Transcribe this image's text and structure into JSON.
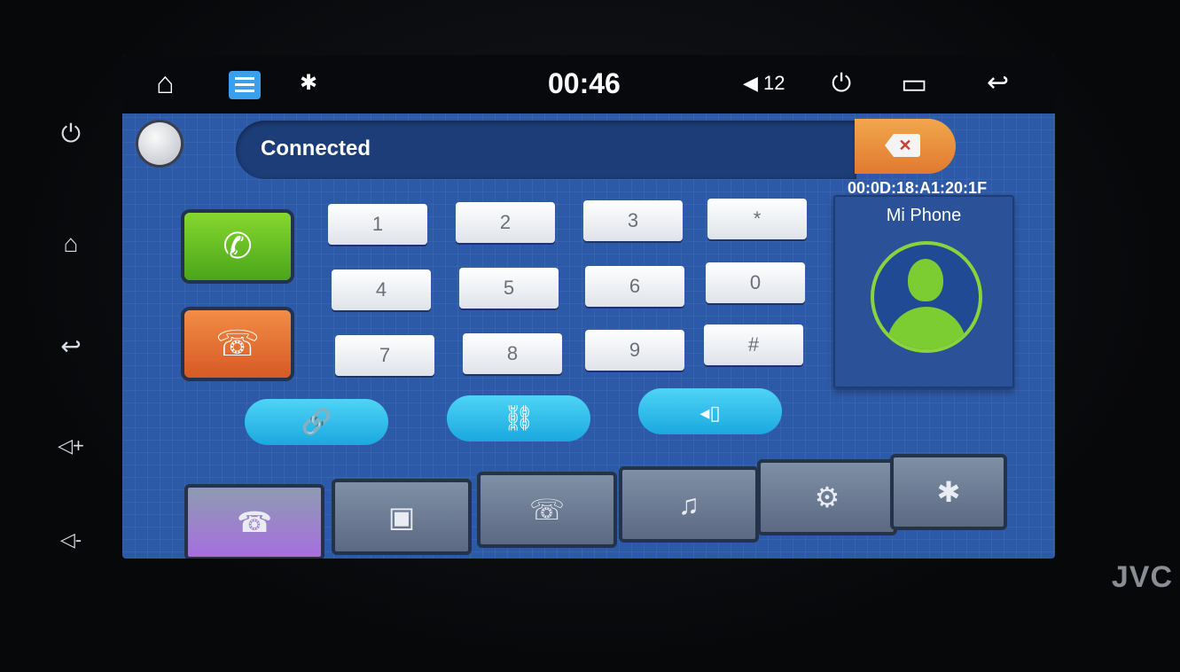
{
  "status_bar": {
    "clock": "00:46",
    "volume": "12",
    "home_icon": "⌂",
    "bluetooth_icon": "✱",
    "power_icon": "⏻",
    "recent_icon": "▭",
    "back_icon": "↩"
  },
  "side_keys": {
    "power": "⏻",
    "home": "⌂",
    "back": "↩",
    "vol_up": "◁+",
    "vol_down": "◁-"
  },
  "brand": "JVC",
  "phone": {
    "status": "Connected",
    "mac": "00:0D:18:A1:20:1F",
    "device_name": "Mi Phone"
  },
  "keypad": [
    "1",
    "2",
    "3",
    "*",
    "4",
    "5",
    "6",
    "0",
    "7",
    "8",
    "9",
    "#"
  ],
  "actions": {
    "connect_icon": "🔗",
    "disconnect_icon": "⛓",
    "transfer_icon": "◂▯"
  },
  "tabs": [
    {
      "icon": "☎"
    },
    {
      "icon": "▣"
    },
    {
      "icon": "☏"
    },
    {
      "icon": "♫"
    },
    {
      "icon": "⚙"
    },
    {
      "icon": "✱"
    }
  ]
}
